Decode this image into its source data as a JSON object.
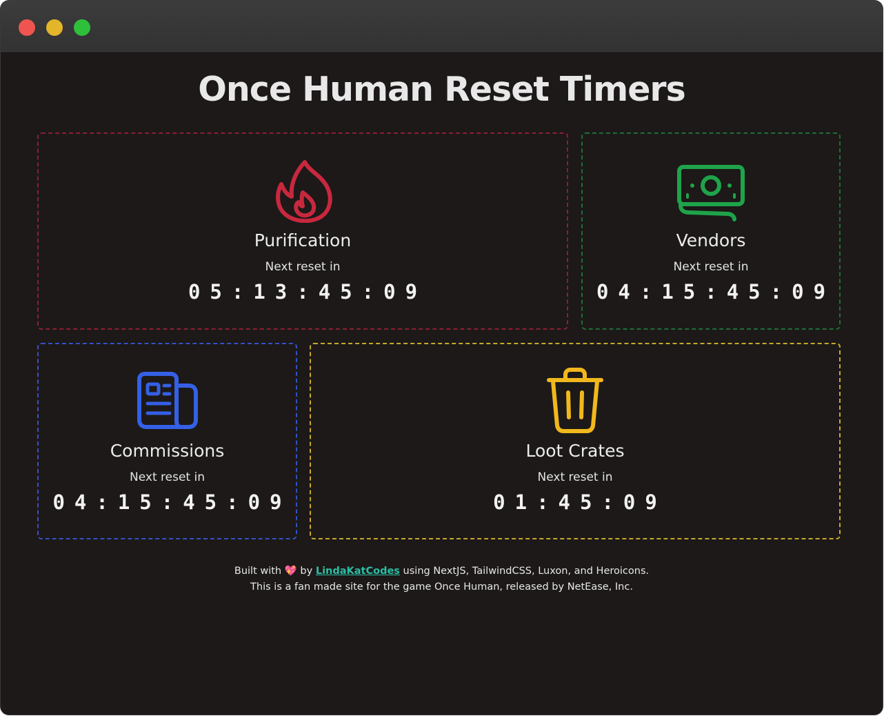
{
  "page": {
    "title": "Once Human Reset Timers"
  },
  "cards": {
    "purification": {
      "title": "Purification",
      "subtitle": "Next reset in",
      "timer": "05:13:45:09",
      "icon": "fire-icon",
      "color": "#c8283e"
    },
    "vendors": {
      "title": "Vendors",
      "subtitle": "Next reset in",
      "timer": "04:15:45:09",
      "icon": "banknotes-icon",
      "color": "#1fa34a"
    },
    "commissions": {
      "title": "Commissions",
      "subtitle": "Next reset in",
      "timer": "04:15:45:09",
      "icon": "newspaper-icon",
      "color": "#3560e6"
    },
    "loot_crates": {
      "title": "Loot Crates",
      "subtitle": "Next reset in",
      "timer": "01:45:09",
      "icon": "trash-icon",
      "color": "#f1b81d"
    }
  },
  "footer": {
    "built_prefix": "Built with",
    "heart": "💖",
    "by": "by",
    "author_link": "LindaKatCodes",
    "built_suffix": "using NextJS, TailwindCSS, Luxon, and Heroicons.",
    "disclaimer": "This is a fan made site for the game Once Human, released by NetEase, Inc."
  },
  "colors": {
    "background": "#1c1918",
    "link": "#2bbfa4"
  }
}
